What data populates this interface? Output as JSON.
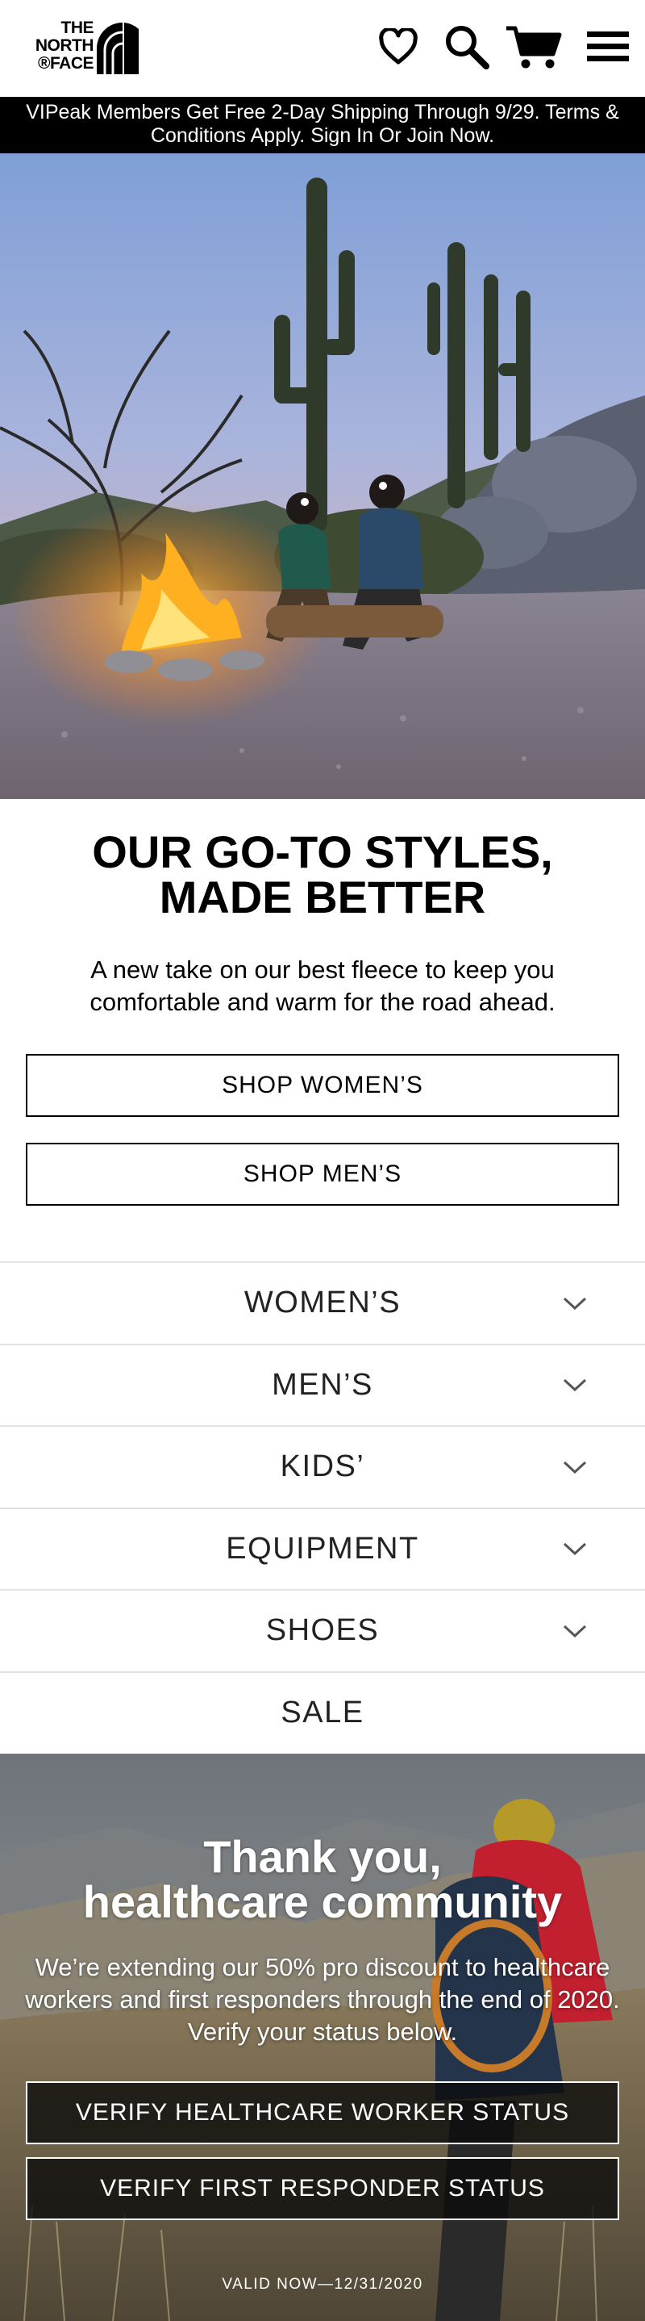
{
  "header": {
    "logo_line1": "THE",
    "logo_line2": "NORTH",
    "logo_line3": "®FACE",
    "icons": [
      "heart-icon",
      "search-icon",
      "cart-icon",
      "menu-icon"
    ]
  },
  "promo_banner": {
    "text": "VIPeak Members Get Free 2-Day Shipping Through 9/29. Terms & Conditions Apply. Sign In Or Join Now."
  },
  "hero": {
    "image": "two people wearing headlamps sitting by a campfire in a saguaro cactus desert at dusk"
  },
  "feature": {
    "headline_line1": "OUR GO-TO STYLES,",
    "headline_line2": "MADE BETTER",
    "subtext": "A new take on our best fleece to keep you comfortable and warm for the road ahead.",
    "shop_womens": "SHOP WOMEN’S",
    "shop_mens": "SHOP MEN’S"
  },
  "nav": {
    "items": [
      {
        "label": "WOMEN’S",
        "expandable": true
      },
      {
        "label": "MEN’S",
        "expandable": true
      },
      {
        "label": "KIDS’",
        "expandable": true
      },
      {
        "label": "EQUIPMENT",
        "expandable": true
      },
      {
        "label": "SHOES",
        "expandable": true
      },
      {
        "label": "SALE",
        "expandable": false
      }
    ]
  },
  "healthcare": {
    "title_line1": "Thank you,",
    "title_line2": "healthcare community",
    "body": "We’re extending our 50% pro discount to healthcare workers and first responders through the end of 2020. Verify your status below.",
    "verify_healthcare": "VERIFY HEALTHCARE WORKER STATUS",
    "verify_first_responder": "VERIFY FIRST RESPONDER STATUS",
    "valid_text": "VALID NOW—12/31/2020"
  },
  "colors": {
    "banner_bg": "#000000",
    "text": "#000000",
    "divider": "#e3e3e3"
  }
}
